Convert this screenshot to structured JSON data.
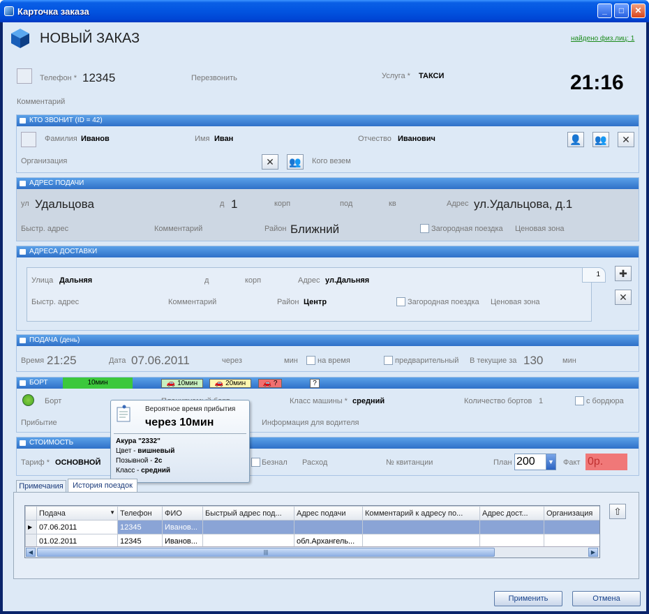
{
  "window": {
    "title": "Карточка заказа",
    "min": "_",
    "max": "□",
    "close": "✕"
  },
  "header": {
    "title": "НОВЫЙ ЗАКАЗ",
    "found_link": "найдено физ.лиц: 1"
  },
  "top": {
    "phone_label": "Телефон *",
    "phone_value": "12345",
    "callback_label": "Перезвонить",
    "service_label": "Услуга *",
    "service_value": "ТАКСИ",
    "time": "21:16",
    "comment_label": "Комментарий"
  },
  "caller": {
    "title": "КТО ЗВОНИТ (ID = 42)",
    "surname_label": "Фамилия",
    "surname": "Иванов",
    "name_label": "Имя",
    "name": "Иван",
    "patronymic_label": "Отчество",
    "patronymic": "Иванович",
    "org_label": "Организация",
    "who_label": "Кого везем"
  },
  "pickup": {
    "title": "АДРЕС ПОДАЧИ",
    "street_label": "ул",
    "street": "Удальцова",
    "house_label": "д",
    "house": "1",
    "korp_label": "корп",
    "pod_label": "под",
    "kv_label": "кв",
    "address_label": "Адрес",
    "address": "ул.Удальцова, д.1",
    "quick_label": "Быстр. адрес",
    "comment_label": "Комментарий",
    "district_label": "Район",
    "district": "Ближний",
    "suburban_label": "Загородная поездка",
    "zone_label": "Ценовая зона"
  },
  "delivery": {
    "title": "АДРЕСА ДОСТАВКИ",
    "street_label": "Улица",
    "street": "Дальняя",
    "house_label": "д",
    "korp_label": "корп",
    "address_label": "Адрес",
    "address": "ул.Дальняя",
    "quick_label": "Быстр. адрес",
    "comment_label": "Комментарий",
    "district_label": "Район",
    "district": "Центр",
    "suburban_label": "Загородная поездка",
    "zone_label": "Ценовая зона",
    "tab_number": "1"
  },
  "supply": {
    "title": "ПОДАЧА (день)",
    "time_label": "Время",
    "time": "21:25",
    "date_label": "Дата",
    "date": "07.06.2011",
    "after_label": "через",
    "min_label": "мин",
    "ontime_label": "на время",
    "prelim_label": "предварительный",
    "current_label": "В текущие за",
    "current_value": "130",
    "min2_label": "мин"
  },
  "board": {
    "title": "БОРТ",
    "bar_label": "10мин",
    "tag1": "10мин",
    "tag2": "20мин",
    "tag3": "?",
    "tag4": "?",
    "board_label": "Борт",
    "planned_label": "Планируемый борт",
    "class_label": "Класс машины *",
    "class_value": "средний",
    "count_label": "Количество бортов",
    "count_value": "1",
    "curb_label": "с бордюра",
    "arrival_label": "Прибытие",
    "driver_info_label": "Информация для водителя"
  },
  "tooltip": {
    "subtitle": "Вероятное время прибытия",
    "title": "через 10мин",
    "car": "Акура \"2332\"",
    "color_label": "Цвет - ",
    "color_value": "вишневый",
    "call_label": "Позывной - ",
    "call_value": "2с",
    "class_label": "Класс - ",
    "class_value": "средний"
  },
  "cost": {
    "title": "СТОИМОСТЬ",
    "tariff_label": "Тариф *",
    "tariff": "ОСНОВНОЙ",
    "cashless_label": "Безнал",
    "expense_label": "Расход",
    "receipt_label": "№ квитанции",
    "plan_label": "План",
    "plan_value": "200",
    "fact_label": "Факт",
    "fact_value": "0р."
  },
  "tabs": [
    {
      "label": "Примечания"
    },
    {
      "label": "История поездок"
    }
  ],
  "grid": {
    "columns": [
      "Подача",
      "Телефон",
      "ФИО",
      "Быстрый адрес под...",
      "Адрес подачи",
      "Комментарий к адресу по...",
      "Адрес дост...",
      "Организация"
    ],
    "rows": [
      [
        "07.06.2011",
        "12345",
        "Иванов...",
        "",
        "",
        "",
        "",
        ""
      ],
      [
        "01.02.2011",
        "12345",
        "Иванов...",
        "",
        "обл.Архангель...",
        "",
        "",
        ""
      ]
    ]
  },
  "buttons": {
    "apply": "Применить",
    "cancel": "Отмена"
  }
}
